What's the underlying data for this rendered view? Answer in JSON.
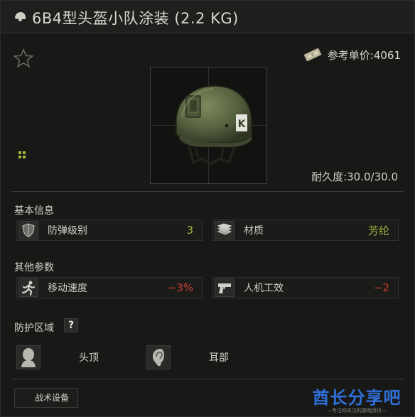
{
  "header": {
    "title": "6B4型头盔小队涂装 (2.2 KG)",
    "icon": "helmet-icon"
  },
  "price": {
    "label": "参考单价:",
    "value": "4061",
    "icon": "money-icon"
  },
  "favorite": {
    "icon": "star-outline-icon"
  },
  "durability": {
    "label": "耐久度:",
    "value": "30.0/30.0"
  },
  "basic_info": {
    "title": "基本信息",
    "stats": [
      {
        "label": "防弹级别",
        "value": "3",
        "icon": "armor-shield-icon",
        "status": "good"
      },
      {
        "label": "材质",
        "value": "芳纶",
        "icon": "material-icon",
        "status": "good"
      }
    ]
  },
  "other_params": {
    "title": "其他参数",
    "stats": [
      {
        "label": "移动速度",
        "value": "−3%",
        "icon": "running-man-icon",
        "status": "bad"
      },
      {
        "label": "人机工效",
        "value": "−2",
        "icon": "pistol-icon",
        "status": "bad"
      }
    ]
  },
  "protection": {
    "title": "防护区域",
    "help_label": "?",
    "zones": [
      {
        "label": "头顶",
        "icon": "head-top-icon"
      },
      {
        "label": "耳部",
        "icon": "ear-icon"
      }
    ]
  },
  "tabs": [
    {
      "label": "战术设备"
    }
  ],
  "watermark": {
    "main": "酋长分享吧",
    "sub": "—专注你关注的游戏资讯—"
  },
  "colors": {
    "good": "#9fb83e",
    "bad": "#c4402f",
    "background": "#181817",
    "watermark": "#2f6fd8"
  }
}
